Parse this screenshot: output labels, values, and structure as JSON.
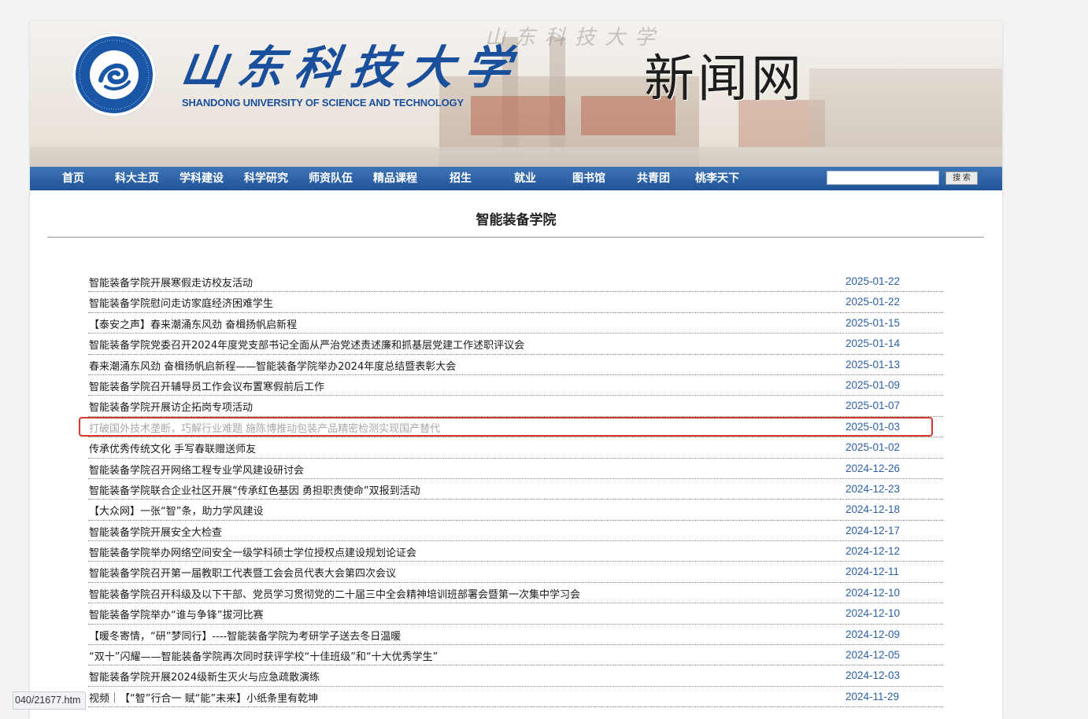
{
  "header": {
    "logo_icon": "university-seal-icon",
    "university_cn": "山东科技大学",
    "university_en": "SHANDONG UNIVERSITY OF SCIENCE AND TECHNOLOGY",
    "site_title": "新闻网"
  },
  "nav": {
    "items": [
      "首页",
      "科大主页",
      "学科建设",
      "科学研究",
      "师资队伍",
      "精品课程",
      "招生",
      "就业",
      "图书馆",
      "共青团",
      "桃李天下"
    ],
    "search_value": "",
    "search_button": "搜 索"
  },
  "section": {
    "title": "智能装备学院"
  },
  "news": [
    {
      "title": "智能装备学院开展寒假走访校友活动",
      "date": "2025-01-22"
    },
    {
      "title": "智能装备学院慰问走访家庭经济困难学生",
      "date": "2025-01-22"
    },
    {
      "title": "【泰安之声】春来潮涌东风劲 奋楫扬帆启新程",
      "date": "2025-01-15"
    },
    {
      "title": "智能装备学院党委召开2024年度党支部书记全面从严治党述责述廉和抓基层党建工作述职评议会",
      "date": "2025-01-14"
    },
    {
      "title": "春来潮涌东风劲 奋楫扬帆启新程——智能装备学院举办2024年度总结暨表彰大会",
      "date": "2025-01-13"
    },
    {
      "title": "智能装备学院召开辅导员工作会议布置寒假前后工作",
      "date": "2025-01-09"
    },
    {
      "title": "智能装备学院开展访企拓岗专项活动",
      "date": "2025-01-07"
    },
    {
      "title": "打破国外技术垄断，巧解行业难题 施陈博推动包装产品精密检测实现国产替代",
      "date": "2025-01-03"
    },
    {
      "title": "传承优秀传统文化 手写春联赠送师友",
      "date": "2025-01-02"
    },
    {
      "title": "智能装备学院召开网络工程专业学风建设研讨会",
      "date": "2024-12-26"
    },
    {
      "title": "智能装备学院联合企业社区开展“传承红色基因 勇担职责使命”双报到活动",
      "date": "2024-12-23"
    },
    {
      "title": "【大众网】一张“智”条，助力学风建设",
      "date": "2024-12-18"
    },
    {
      "title": "智能装备学院开展安全大检查",
      "date": "2024-12-17"
    },
    {
      "title": "智能装备学院举办网络空间安全一级学科硕士学位授权点建设规划论证会",
      "date": "2024-12-12"
    },
    {
      "title": "智能装备学院召开第一届教职工代表暨工会会员代表大会第四次会议",
      "date": "2024-12-11"
    },
    {
      "title": "智能装备学院召开科级及以下干部、党员学习贯彻党的二十届三中全会精神培训班部署会暨第一次集中学习会",
      "date": "2024-12-10"
    },
    {
      "title": "智能装备学院举办“谁与争锋”拔河比赛",
      "date": "2024-12-10"
    },
    {
      "title": "【暖冬寄情，“研”梦同行】----智能装备学院为考研学子送去冬日温暖",
      "date": "2024-12-09"
    },
    {
      "title": "“双十”闪耀——智能装备学院再次同时获评学校“十佳班级”和“十大优秀学生”",
      "date": "2024-12-05"
    },
    {
      "title": "智能装备学院开展2024级新生灭火与应急疏散演练",
      "date": "2024-12-03"
    },
    {
      "title": "视频｜【“智”行合一 赋“能”未来】小纸条里有乾坤",
      "date": "2024-11-29"
    }
  ],
  "highlighted_index": 7,
  "status_bar": {
    "url": "040/21677.htm"
  },
  "colors": {
    "nav_bg": "#2a5ea1",
    "date_blue": "#2c5fa8",
    "highlight_red": "#d63a2e",
    "brand_blue": "#1a4f9c"
  }
}
